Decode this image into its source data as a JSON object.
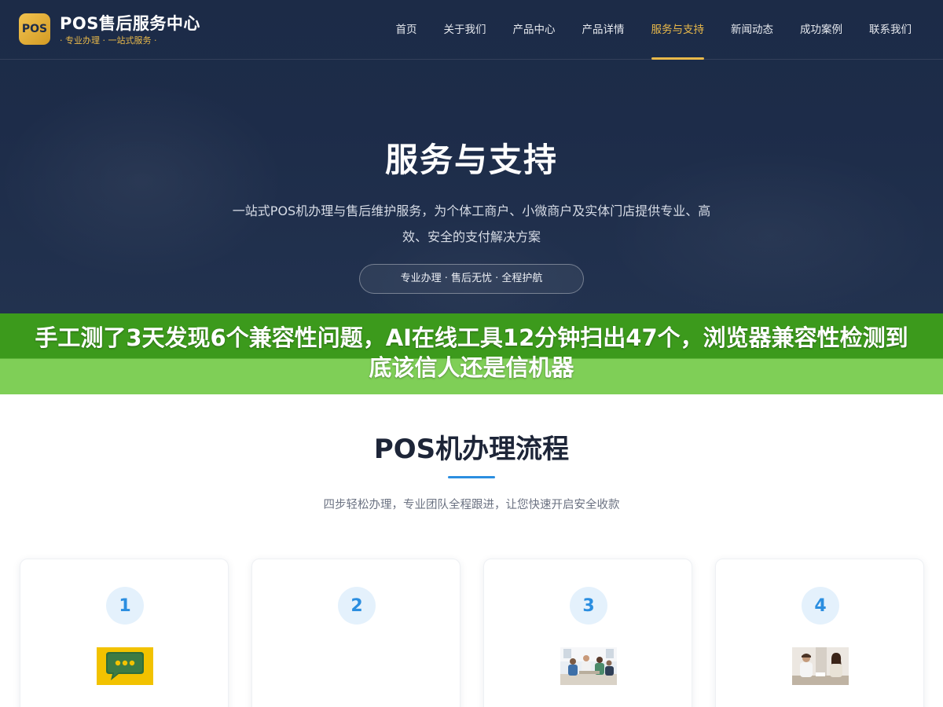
{
  "header": {
    "logo_badge": "POS",
    "logo_title": "POS售后服务中心",
    "logo_subtitle": "· 专业办理 · 一站式服务 ·",
    "nav": [
      {
        "label": "首页",
        "active": false
      },
      {
        "label": "关于我们",
        "active": false
      },
      {
        "label": "产品中心",
        "active": false
      },
      {
        "label": "产品详情",
        "active": false
      },
      {
        "label": "服务与支持",
        "active": true
      },
      {
        "label": "新闻动态",
        "active": false
      },
      {
        "label": "成功案例",
        "active": false
      },
      {
        "label": "联系我们",
        "active": false
      }
    ]
  },
  "hero": {
    "title": "服务与支持",
    "description": "一站式POS机办理与售后维护服务，为个体工商户、小微商户及实体门店提供专业、高效、安全的支付解决方案",
    "pill": "专业办理 · 售后无忧 · 全程护航"
  },
  "banner": {
    "text": "手工测了3天发现6个兼容性问题，AI在线工具12分钟扫出47个，浏览器兼容性检测到底该信人还是信机器"
  },
  "process": {
    "title": "POS机办理流程",
    "subtitle": "四步轻松办理，专业团队全程跟进，让您快速开启安全收款",
    "steps": [
      {
        "number": "1",
        "image": "chat-bubble-image"
      },
      {
        "number": "2",
        "image": ""
      },
      {
        "number": "3",
        "image": "team-meeting-photo"
      },
      {
        "number": "4",
        "image": "consultation-photo"
      }
    ]
  },
  "colors": {
    "hero_bg": "#1d2c49",
    "accent_gold": "#e8b84a",
    "banner_dark": "#3c9a1c",
    "banner_light": "#7fcf57",
    "accent_blue": "#2b8ee0"
  }
}
